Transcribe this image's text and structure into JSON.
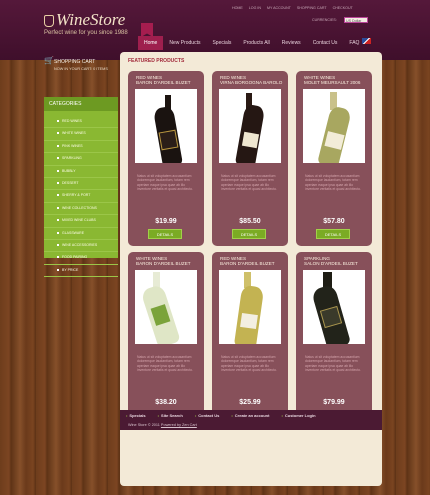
{
  "header": {
    "logo": "WineStore",
    "tagline": "Perfect wine for you since 1988",
    "top_links": [
      "HOME",
      "LOG IN",
      "MY ACCOUNT",
      "SHOPPING CART",
      "CHECKOUT"
    ],
    "currency_label": "CURRENCIES:",
    "currency_value": "US Dollar",
    "nav": [
      "Home",
      "New Products",
      "Specials",
      "Products All",
      "Reviews",
      "Contact Us",
      "FAQ"
    ]
  },
  "cart": {
    "title": "SHOPPING CART",
    "subtitle": "NOW IN YOUR CART: 0 ITEMS"
  },
  "categories": {
    "title": "CATEGORIES",
    "items": [
      "RED WINES",
      "WHITE WINES",
      "PINK WINES",
      "SPARKLING",
      "BUBBLY",
      "DESSERT",
      "SHERRY & PORT",
      "WINE COLLECTIONS",
      "MIXED WINE CLUBS",
      "GLASSWARE",
      "WINE ACCESSORIES",
      "FOOD PAIRING",
      "BY PRICE"
    ]
  },
  "featured": {
    "title": "FEATURED PRODUCTS",
    "description": "Natus ut sit voluptatem accusantium doloremque laudantium, totam rem aperiam eaque ipsa quae ab illo inventore veritatis et quasi architecto.",
    "button_label": "DETAILS",
    "products": [
      {
        "category": "RED WINES",
        "name": "BARON D'ARDEIL BUZET",
        "price": "$19.99"
      },
      {
        "category": "RED WINES",
        "name": "VIRNA BORGOGNA BAROLO",
        "price": "$85.50"
      },
      {
        "category": "WHITE WINES",
        "name": "MOLET MEURSAULT 2006",
        "price": "$57.80"
      },
      {
        "category": "WHITE WINES",
        "name": "BARON D'ARDEIL BUZET",
        "price": "$38.20"
      },
      {
        "category": "RED WINES",
        "name": "BARON D'ARDEIL BUZET",
        "price": "$25.99"
      },
      {
        "category": "SPARKLING",
        "name": "SALON D'ARDEIL BUZET",
        "price": "$79.99"
      }
    ]
  },
  "footer": {
    "links": [
      "Specials",
      "Site Search",
      "Contact Us",
      "Create an account",
      "Customer Login"
    ],
    "copyright": "Wine Store © 2011",
    "powered": "Powered by Zen Cart"
  },
  "colors": {
    "header": "#4a1233",
    "sidebar": "#8ab832",
    "card": "#87505a",
    "accent": "#7bab24",
    "panel": "#f3ead7"
  }
}
